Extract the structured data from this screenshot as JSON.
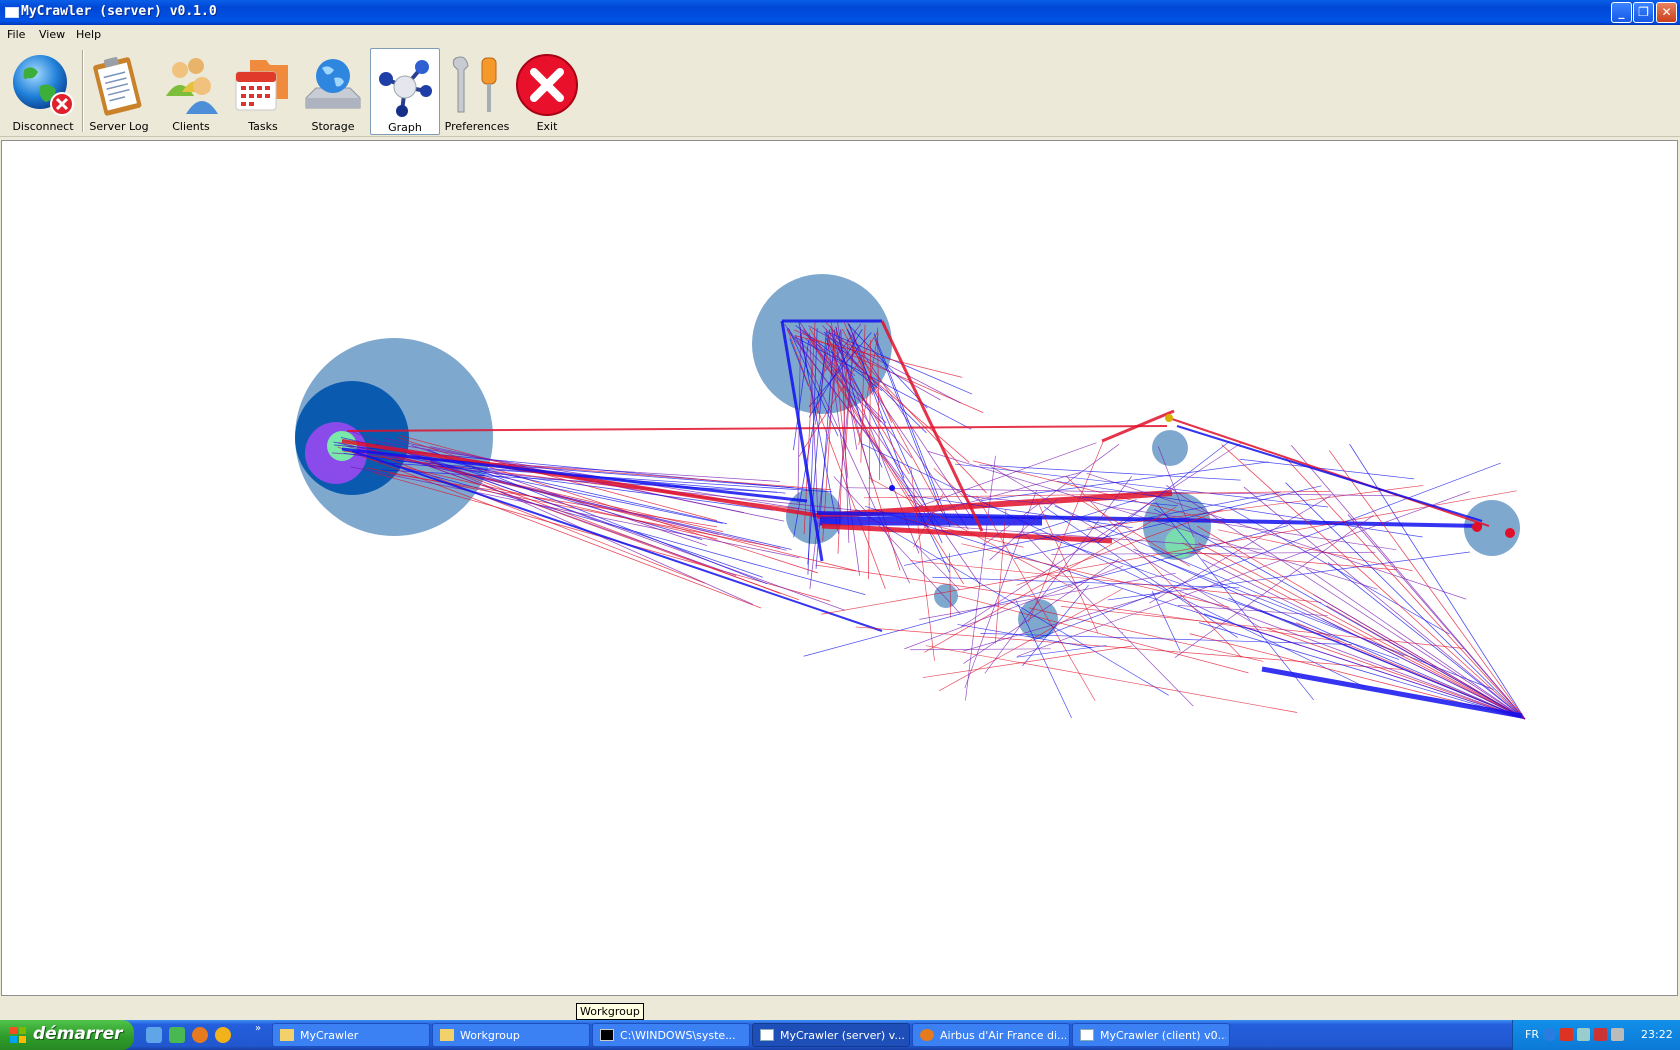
{
  "window": {
    "title": "MyCrawler (server) v0.1.0"
  },
  "menu": {
    "file": "File",
    "view": "View",
    "help": "Help"
  },
  "toolbar": {
    "disconnect": "Disconnect",
    "server_log": "Server Log",
    "clients": "Clients",
    "tasks": "Tasks",
    "storage": "Storage",
    "graph": "Graph",
    "preferences": "Preferences",
    "exit": "Exit",
    "active": "Graph"
  },
  "tooltip": "Workgroup",
  "taskbar": {
    "start_label": "démarrer",
    "tasks": [
      "MyCrawler",
      "Workgroup",
      "C:\\WINDOWS\\syste...",
      "MyCrawler (server) v...",
      "Airbus d'Air France di...",
      "MyCrawler (client) v0..."
    ],
    "language": "FR",
    "clock": "23:22"
  },
  "graph": {
    "colors": {
      "edge_start": "#e0102a",
      "edge_end": "#1010ee",
      "node": "#7fa8cf",
      "node_dark": "#0a5bb0",
      "node_purple": "#8a4bea",
      "node_green": "#7ae8a8"
    }
  }
}
